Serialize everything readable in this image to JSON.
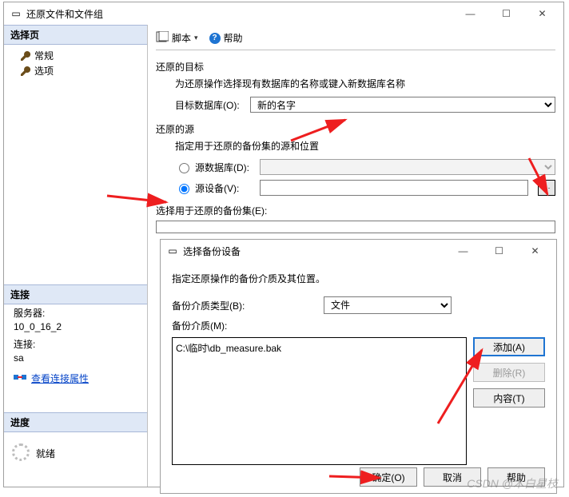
{
  "window_main": {
    "title": "还原文件和文件组",
    "script_btn": "脚本",
    "help_btn": "帮助",
    "sidebar": {
      "select_page": "选择页",
      "items": [
        "常规",
        "选项"
      ],
      "conn_section": "连接",
      "server_label": "服务器:",
      "server_value": "10_0_16_2",
      "connection_label": "连接:",
      "connection_value": "sa",
      "view_props": "查看连接属性",
      "progress_section": "进度",
      "progress_status": "就绪"
    },
    "target_section": "还原的目标",
    "target_hint": "为还原操作选择现有数据库的名称或键入新数据库名称",
    "target_db_label": "目标数据库(O):",
    "target_db_value": "新的名字",
    "source_section": "还原的源",
    "source_hint": "指定用于还原的备份集的源和位置",
    "source_db_radio": "源数据库(D):",
    "source_device_radio": "源设备(V):",
    "ellipsis": "...",
    "backup_set_label": "选择用于还原的备份集(E):"
  },
  "window_sub": {
    "title": "选择备份设备",
    "hint": "指定还原操作的备份介质及其位置。",
    "media_type_label": "备份介质类型(B):",
    "media_type_value": "文件",
    "media_label": "备份介质(M):",
    "media_file": "C:\\临时\\db_measure.bak",
    "btn_add": "添加(A)",
    "btn_del": "删除(R)",
    "btn_content": "内容(T)",
    "btn_ok": "确定(O)",
    "btn_cancel": "取消",
    "btn_help": "帮助"
  },
  "watermark": "CSDN @木白星枝"
}
